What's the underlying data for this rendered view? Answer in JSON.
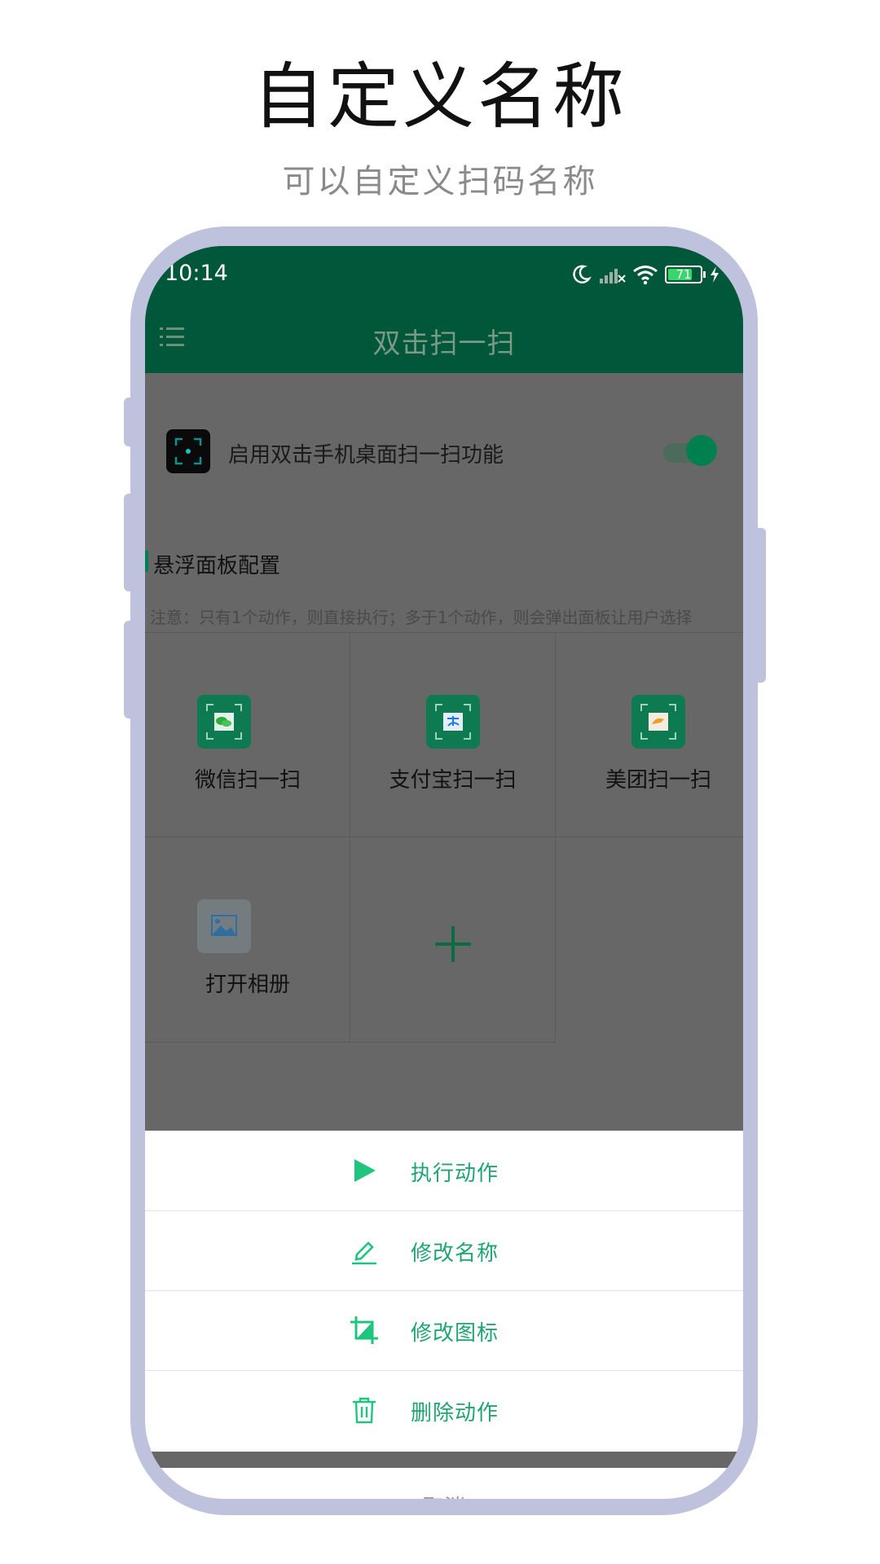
{
  "headline": "自定义名称",
  "subline": "可以自定义扫码名称",
  "status_bar": {
    "time": "10:14",
    "battery": "71"
  },
  "app_bar": {
    "title": "双击扫一扫",
    "menu_icon": "menu-list-icon"
  },
  "enable": {
    "label": "启用双击手机桌面扫一扫功能",
    "toggle_on": true
  },
  "panel": {
    "title": "悬浮面板配置",
    "notice": "注意：只有1个动作，则直接执行；多于1个动作，则会弹出面板让用户选择",
    "actions": [
      {
        "label": "微信扫一扫",
        "icon": "wechat-scan-icon"
      },
      {
        "label": "支付宝扫一扫",
        "icon": "alipay-scan-icon"
      },
      {
        "label": "美团扫一扫",
        "icon": "meituan-scan-icon"
      },
      {
        "label": "打开相册",
        "icon": "album-icon"
      }
    ],
    "add_icon": "plus-icon"
  },
  "sheet": {
    "items": [
      {
        "label": "执行动作",
        "icon": "play-icon"
      },
      {
        "label": "修改名称",
        "icon": "edit-icon"
      },
      {
        "label": "修改图标",
        "icon": "crop-icon"
      },
      {
        "label": "删除动作",
        "icon": "trash-icon"
      }
    ],
    "cancel": "取消"
  },
  "colors": {
    "brand_green": "#00573a",
    "accent_green": "#1ea573",
    "frame": "#bfc2dc",
    "overlay": "#676767"
  }
}
